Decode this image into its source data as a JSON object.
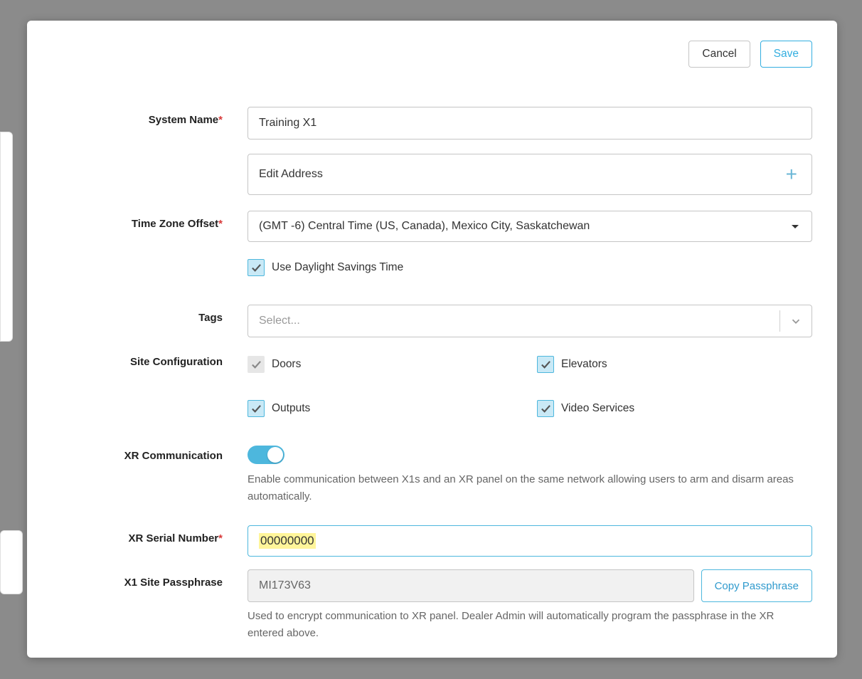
{
  "actions": {
    "cancel": "Cancel",
    "save": "Save"
  },
  "labels": {
    "system_name": "System Name",
    "time_zone": "Time Zone Offset",
    "tags": "Tags",
    "site_config": "Site Configuration",
    "xr_comm": "XR Communication",
    "xr_serial": "XR Serial Number",
    "x1_passphrase": "X1 Site Passphrase"
  },
  "fields": {
    "system_name_value": "Training X1",
    "edit_address": "Edit Address",
    "timezone_value": "(GMT -6) Central Time (US, Canada), Mexico City, Saskatchewan",
    "dst_label": "Use Daylight Savings Time",
    "tags_placeholder": "Select...",
    "doors": "Doors",
    "elevators": "Elevators",
    "outputs": "Outputs",
    "video_services": "Video Services",
    "xr_comm_help": "Enable communication between X1s and an XR panel on the same network allowing users to arm and disarm areas automatically.",
    "xr_serial_value": "00000000",
    "passphrase_value": "MI173V63",
    "copy_passphrase": "Copy Passphrase",
    "passphrase_help": "Used to encrypt communication to XR panel. Dealer Admin will automatically program the passphrase in the XR entered above."
  }
}
